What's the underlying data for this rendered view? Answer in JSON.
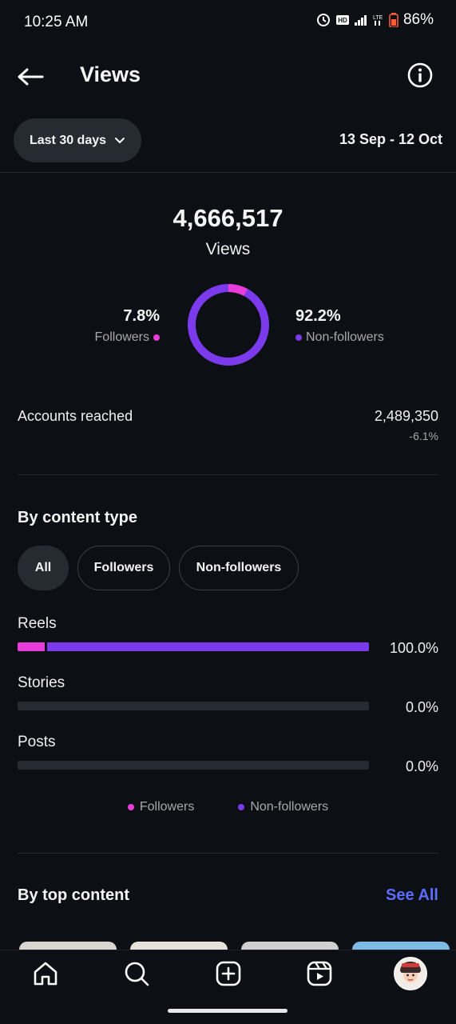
{
  "status": {
    "time": "10:25 AM",
    "battery": "86%"
  },
  "header": {
    "title": "Views"
  },
  "filter": {
    "range_label": "Last 30 days",
    "date_range": "13 Sep - 12 Oct"
  },
  "summary": {
    "total_views": "4,666,517",
    "views_label": "Views",
    "followers_pct": "7.8%",
    "followers_label": "Followers",
    "non_followers_pct": "92.2%",
    "non_followers_label": "Non-followers",
    "followers_fraction": 0.078
  },
  "accounts_reached": {
    "label": "Accounts reached",
    "value": "2,489,350",
    "change": "-6.1%"
  },
  "content_type": {
    "title": "By content type",
    "chips": [
      "All",
      "Followers",
      "Non-followers"
    ],
    "rows": [
      {
        "label": "Reels",
        "pct": "100.0%",
        "followers": 0.078,
        "non_followers": 0.922
      },
      {
        "label": "Stories",
        "pct": "0.0%",
        "followers": 0,
        "non_followers": 0
      },
      {
        "label": "Posts",
        "pct": "0.0%",
        "followers": 0,
        "non_followers": 0
      }
    ],
    "legend": [
      "Followers",
      "Non-followers"
    ]
  },
  "top_content": {
    "title": "By top content",
    "see_all": "See All"
  },
  "colors": {
    "followers": "#e83cdb",
    "non_followers": "#7c3aed",
    "link": "#5b6cff",
    "background": "#0c1014"
  }
}
